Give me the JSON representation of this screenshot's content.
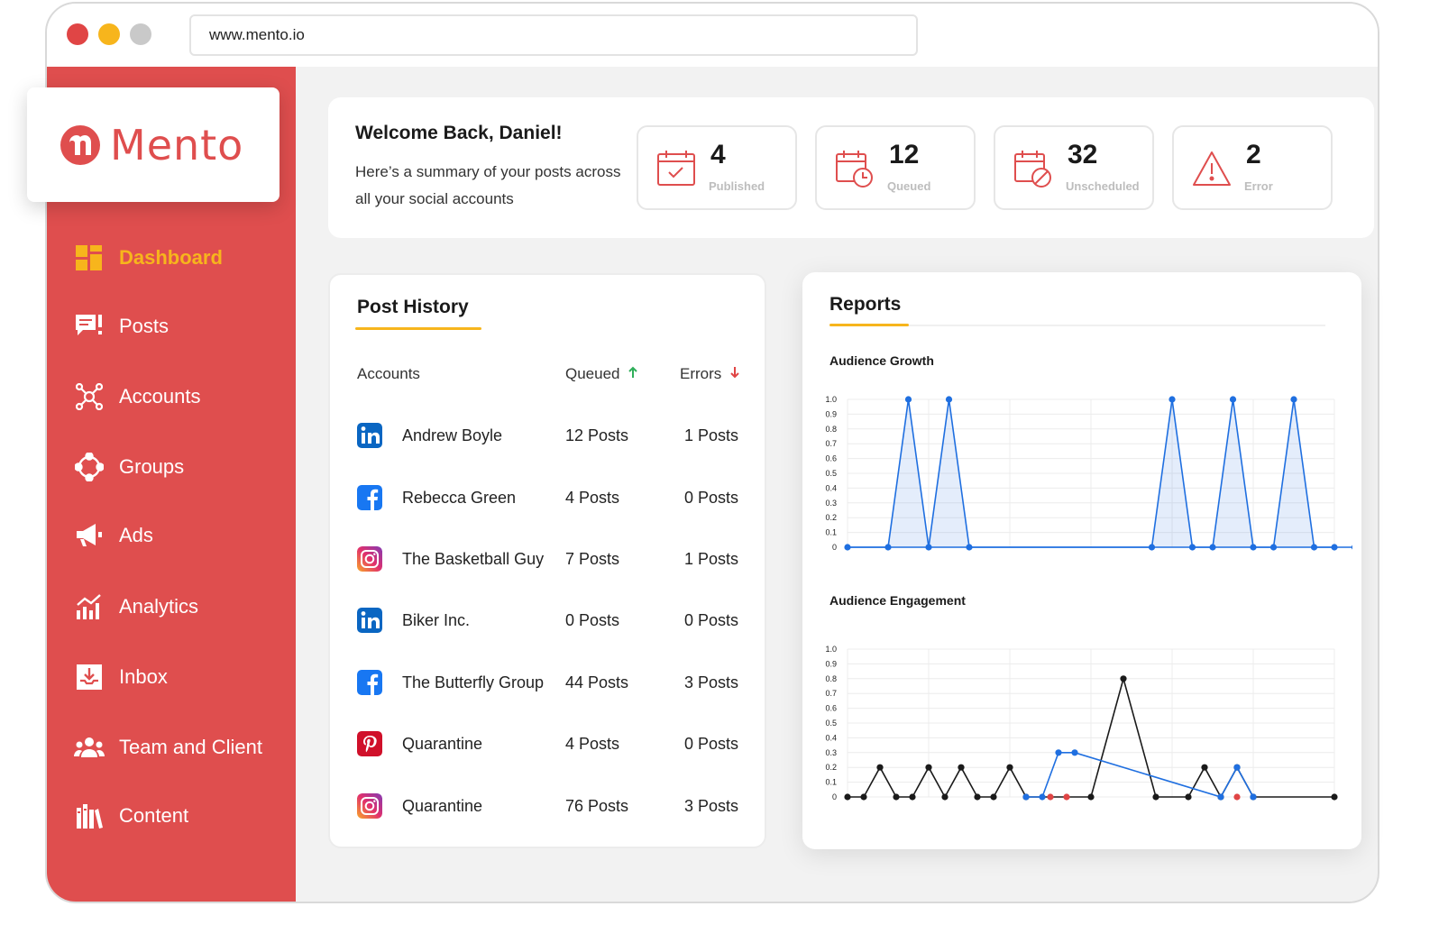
{
  "browser": {
    "url": "www.mento.io"
  },
  "brand": {
    "name": "Mento",
    "color": "#df4e4e",
    "accent": "#f7b51c"
  },
  "sidebar": {
    "items": [
      {
        "label": "Dashboard",
        "icon": "dashboard-icon",
        "active": true
      },
      {
        "label": "Posts",
        "icon": "posts-icon"
      },
      {
        "label": "Accounts",
        "icon": "accounts-icon"
      },
      {
        "label": "Groups",
        "icon": "groups-icon"
      },
      {
        "label": "Ads",
        "icon": "megaphone-icon"
      },
      {
        "label": "Analytics",
        "icon": "analytics-icon"
      },
      {
        "label": "Inbox",
        "icon": "inbox-icon"
      },
      {
        "label": "Team and Client",
        "icon": "team-icon"
      },
      {
        "label": "Content",
        "icon": "books-icon"
      }
    ]
  },
  "welcome": {
    "title": "Welcome Back, Daniel!",
    "subtitle": "Here’s a summary of your posts across all your social accounts"
  },
  "stats": [
    {
      "value": "4",
      "label": "Published",
      "icon": "calendar-check-icon"
    },
    {
      "value": "12",
      "label": "Queued",
      "icon": "calendar-clock-icon"
    },
    {
      "value": "32",
      "label": "Unscheduled",
      "icon": "calendar-blocked-icon"
    },
    {
      "value": "2",
      "label": "Error",
      "icon": "warning-icon"
    }
  ],
  "post_history": {
    "title": "Post History",
    "columns": {
      "accounts": "Accounts",
      "queued": "Queued",
      "errors": "Errors"
    },
    "rows": [
      {
        "network": "linkedin",
        "account": "Andrew Boyle",
        "queued": "12 Posts",
        "errors": "1 Posts"
      },
      {
        "network": "facebook",
        "account": "Rebecca Green",
        "queued": "4 Posts",
        "errors": "0 Posts"
      },
      {
        "network": "instagram",
        "account": "The Basketball Guy",
        "queued": "7 Posts",
        "errors": "1 Posts"
      },
      {
        "network": "linkedin",
        "account": "Biker Inc.",
        "queued": "0 Posts",
        "errors": "0 Posts"
      },
      {
        "network": "facebook",
        "account": "The Butterfly Group",
        "queued": "44 Posts",
        "errors": "3 Posts"
      },
      {
        "network": "pinterest",
        "account": "Quarantine",
        "queued": "4 Posts",
        "errors": "0 Posts"
      },
      {
        "network": "instagram",
        "account": "Quarantine",
        "queued": "76 Posts",
        "errors": "3 Posts"
      }
    ]
  },
  "reports": {
    "title": "Reports",
    "chart_data": [
      {
        "type": "area",
        "title": "Audience Growth",
        "ylim": [
          0,
          1.0
        ],
        "yticks": [
          "0",
          "0.1",
          "0.2",
          "0.3",
          "0.4",
          "0.5",
          "0.6",
          "0.7",
          "0.8",
          "0.9",
          "1.0"
        ],
        "grid": true,
        "series": [
          {
            "color": "#1f6fe0",
            "x": [
              0,
              2,
              3,
              4,
              5,
              6,
              15,
              16,
              17,
              18,
              19,
              20,
              21,
              22,
              23,
              24,
              25
            ],
            "values": [
              0,
              0,
              1.0,
              0,
              1.0,
              0,
              0,
              1.0,
              0,
              0,
              1.0,
              0,
              0,
              1.0,
              0,
              0,
              0
            ]
          }
        ],
        "xlim": [
          0,
          24
        ]
      },
      {
        "type": "line",
        "title": "Audience Engagement",
        "ylim": [
          0,
          1.0
        ],
        "yticks": [
          "0",
          "0.1",
          "0.2",
          "0.3",
          "0.4",
          "0.5",
          "0.6",
          "0.7",
          "0.8",
          "0.9",
          "1.0"
        ],
        "grid": true,
        "xlim": [
          0,
          30
        ],
        "series": [
          {
            "color": "#1a1a1a",
            "x": [
              0,
              1,
              2,
              3,
              4,
              5,
              6,
              7,
              8,
              9,
              10,
              11,
              15,
              17,
              19,
              21,
              22,
              23,
              24,
              25,
              30
            ],
            "values": [
              0,
              0,
              0.2,
              0,
              0,
              0.2,
              0,
              0.2,
              0,
              0,
              0.2,
              0,
              0,
              0.8,
              0,
              0,
              0.2,
              0,
              0.2,
              0,
              0
            ]
          },
          {
            "color": "#1f6fe0",
            "x": [
              11,
              12,
              13,
              14,
              23,
              24,
              25
            ],
            "values": [
              0,
              0,
              0.3,
              0.3,
              0,
              0.2,
              0
            ]
          },
          {
            "color": "#e04545",
            "x": [
              12.5,
              13.5,
              24
            ],
            "values": [
              0,
              0,
              0
            ]
          }
        ]
      }
    ]
  }
}
